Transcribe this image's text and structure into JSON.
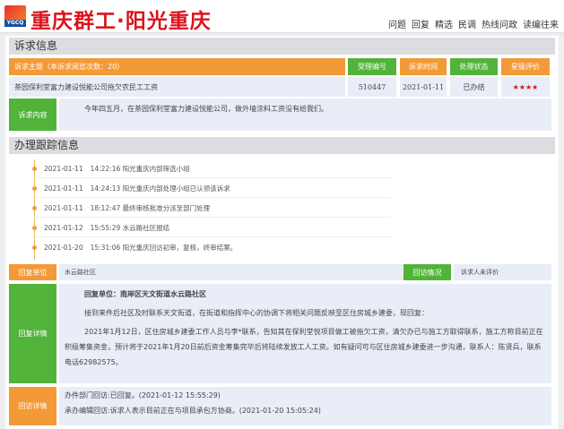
{
  "header": {
    "logo_text": "YGCQ",
    "title": "重庆群工·阳光重庆",
    "nav": [
      "问题",
      "回复",
      "精选",
      "民调",
      "热线问政",
      "读编往来"
    ]
  },
  "appeal": {
    "section_title": "诉求信息",
    "subject_header": "诉求主题（本诉求阅览次数：20）",
    "id_header": "受理编号",
    "time_header": "诉求时间",
    "status_header": "处理状态",
    "rating_header": "星级评价",
    "subject": "茶园保利堂富力建设悦能公司拖欠农民工工资",
    "id": "510447",
    "time": "2021-01-11",
    "status": "已办结",
    "rating": "★★★★",
    "rating_value": 4,
    "content_label": "诉求内容",
    "content": "今年四五月，在茶园保利堂富力建设悦能公司，做外墙涂料工资没有给我们。"
  },
  "tracking": {
    "section_title": "办理跟踪信息",
    "items": [
      {
        "date": "2021-01-11",
        "text": "14:22:16 阳光重庆内部筛选小组"
      },
      {
        "date": "2021-01-11",
        "text": "14:24:13 阳光重庆内部处理小组已认领该诉求"
      },
      {
        "date": "2021-01-11",
        "text": "18:12:47 最终审核批准分派至部门处理"
      },
      {
        "date": "2021-01-12",
        "text": "15:55:29 水云路社区报结"
      },
      {
        "date": "2021-01-20",
        "text": "15:31:06 阳光重庆回访初审，复核，终审结案。"
      }
    ]
  },
  "reply": {
    "unit_label": "回复单位",
    "unit": "水云路社区",
    "visit_label": "回访情况",
    "visit": "诉求人未评价",
    "detail_label": "回复详情",
    "detail_title": "回复单位：南岸区天文街道水云路社区",
    "detail_p1": "接到来件后社区及时联系天文街道，在街道和指挥中心的协调下将相关问题反映至区住房城乡建委，现回复：",
    "detail_p2": "2021年1月12日，区住房城乡建委工作人员与李*联系，告知其在保利堂悦项目做工被拖欠工资，清欠办已与施工方取得联系，施工方称目前正在积极筹集资金，预计将于2021年1月20日前后资金筹集完毕后将陆续发放工人工资。如有疑问可与区住房城乡建委进一步沟通，联系人：陈贤兵，联系电话62982575。",
    "revisit_label": "回访详情",
    "revisit_1": "办件部门回访:已回复。(2021-01-12 15:55:29)",
    "revisit_2": "承办编辑回访:诉求人表示目前正在与项目承包方协商。(2021-01-20 15:05:24)"
  }
}
